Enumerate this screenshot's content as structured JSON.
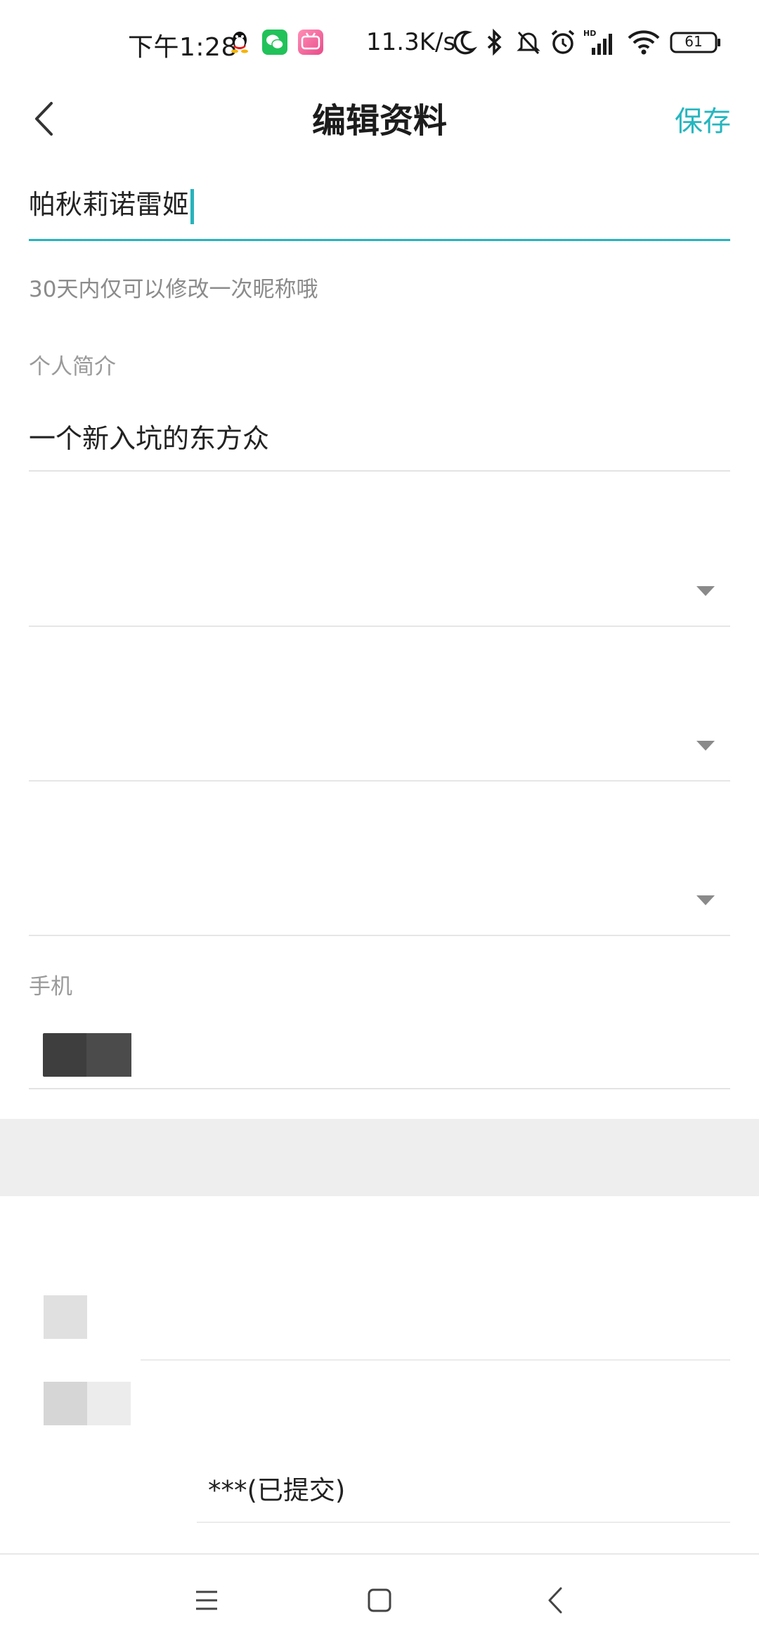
{
  "status_bar": {
    "time": "下午1:28",
    "net_speed": "11.3K/s",
    "battery": "61",
    "icons": [
      "qq-icon",
      "wechat-icon",
      "bilibili-icon",
      "moon-icon",
      "bluetooth-icon",
      "bell-off-icon",
      "alarm-icon",
      "signal-icon",
      "wifi-icon",
      "battery-icon"
    ]
  },
  "header": {
    "title": "编辑资料",
    "save_label": "保存"
  },
  "nickname": {
    "value": "帕秋莉诺雷姬",
    "hint": "30天内仅可以修改一次昵称哦"
  },
  "bio": {
    "label": "个人简介",
    "value": "一个新入坑的东方众"
  },
  "phone": {
    "label": "手机"
  },
  "verification": {
    "value": "***(已提交)"
  },
  "colors": {
    "accent": "#25b6bf",
    "section_gap": "#eeeeee"
  }
}
